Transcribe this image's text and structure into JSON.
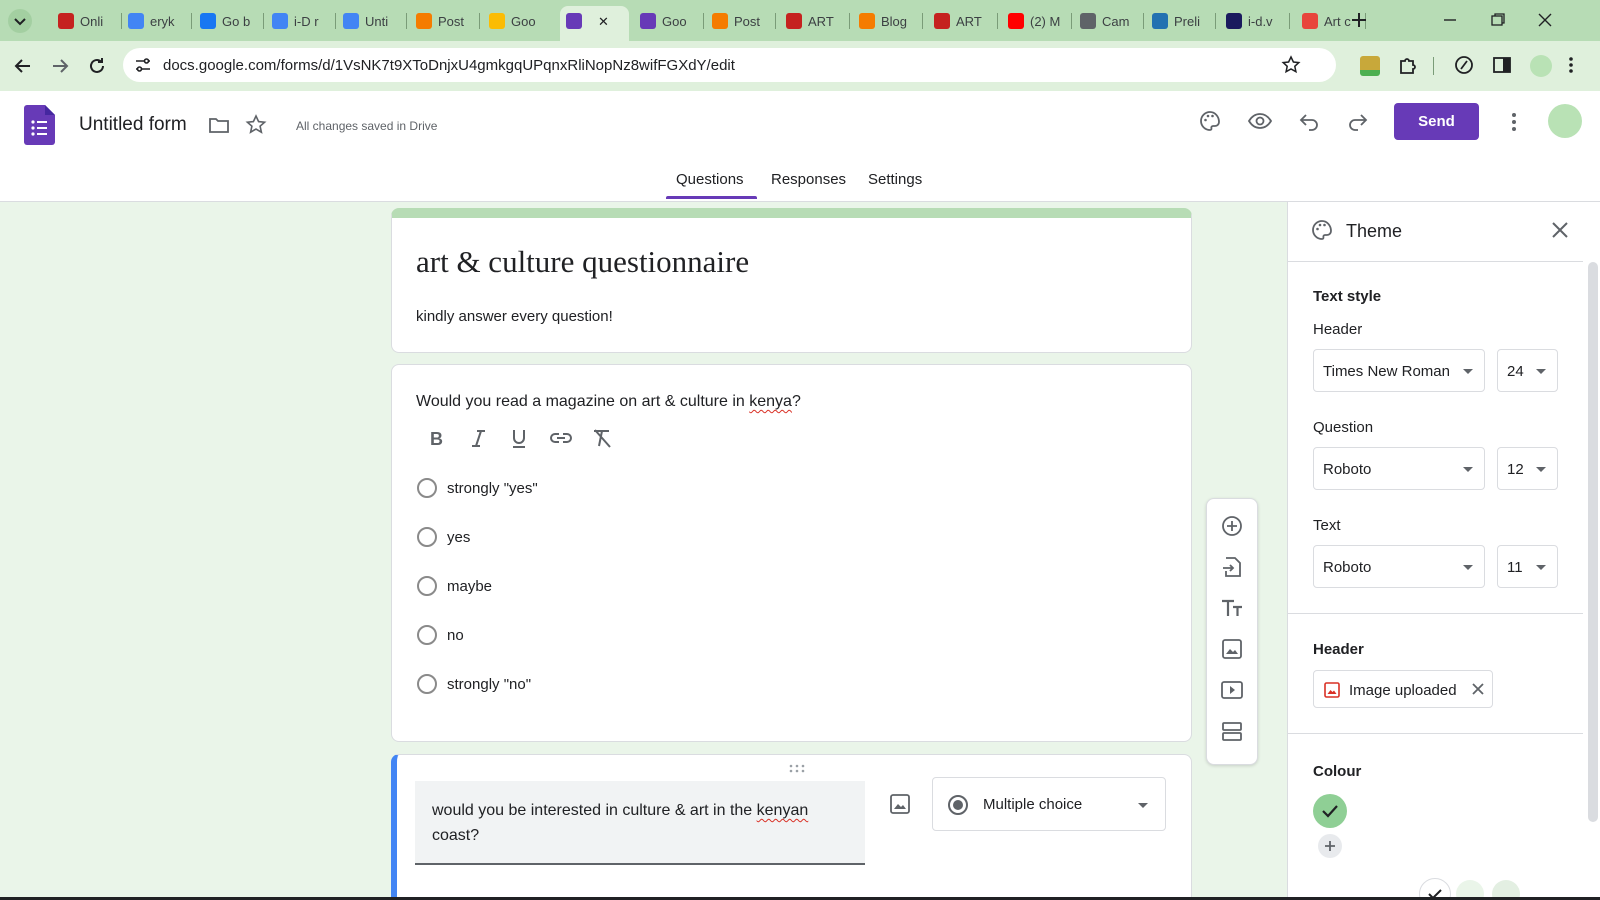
{
  "browser": {
    "tabs": [
      {
        "label": "Onli",
        "color": "#c5221f"
      },
      {
        "label": "eryk",
        "color": "#4285f4"
      },
      {
        "label": "Go b",
        "color": "#1877f2"
      },
      {
        "label": "i-D r",
        "color": "#4285f4"
      },
      {
        "label": "Unti",
        "color": "#4285f4"
      },
      {
        "label": "Post",
        "color": "#f57c00"
      },
      {
        "label": "Goo",
        "color": "#fbbc04"
      },
      {
        "label": "",
        "color": "#673ab7"
      },
      {
        "label": "Goo",
        "color": "#673ab7"
      },
      {
        "label": "Post",
        "color": "#f57c00"
      },
      {
        "label": "ART",
        "color": "#c5221f"
      },
      {
        "label": "Blog",
        "color": "#f57c00"
      },
      {
        "label": "ART",
        "color": "#c5221f"
      },
      {
        "label": "(2) M",
        "color": "#ff0000"
      },
      {
        "label": "Cam",
        "color": "#5f6368"
      },
      {
        "label": "Preli",
        "color": "#2271b1"
      },
      {
        "label": "i-d.v",
        "color": "#1a1a5e"
      },
      {
        "label": "Art c",
        "color": "#e8453c"
      }
    ],
    "url": "docs.google.com/forms/d/1VsNK7t9XToDnjxU4gmkgqUPqnxRliNopNz8wifFGXdY/edit"
  },
  "app": {
    "title": "Untitled form",
    "save_status": "All changes saved in Drive",
    "send_label": "Send",
    "nav_tabs": [
      "Questions",
      "Responses",
      "Settings"
    ]
  },
  "form": {
    "title": "art & culture questionnaire",
    "description": "kindly answer every question!",
    "q1": {
      "text_before": "Would you read a magazine on art & culture in ",
      "text_misspelled": "kenya",
      "text_after": "?",
      "options": [
        "strongly \"yes\"",
        "yes",
        "maybe",
        "no",
        "strongly \"no\""
      ]
    },
    "q2": {
      "text_before": "would you be interested in culture & art in the ",
      "text_misspelled": "kenyan",
      "text_after": " coast?",
      "type_label": "Multiple choice"
    }
  },
  "theme": {
    "title": "Theme",
    "text_style_label": "Text style",
    "header_label": "Header",
    "header_font": "Times New Roman",
    "header_size": "24",
    "question_label": "Question",
    "question_font": "Roboto",
    "question_size": "12",
    "text_label": "Text",
    "text_font": "Roboto",
    "text_size": "11",
    "header_image_label": "Header",
    "header_image_value": "Image uploaded",
    "colour_label": "Colour",
    "selected_color": "#8fcf95"
  },
  "colors": {
    "brand": "#673ab7",
    "accent_bar": "#b7dcb5",
    "focus": "#4285f4"
  }
}
